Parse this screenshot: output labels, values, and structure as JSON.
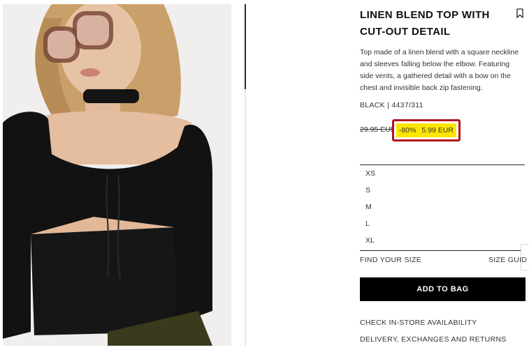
{
  "product": {
    "title": "LINEN BLEND TOP WITH CUT-OUT DETAIL",
    "description": "Top made of a linen blend with a square neckline and sleeves falling below the elbow. Featuring side vents, a gathered detail with a bow on the chest and invisible back zip fastening.",
    "color_ref": "BLACK | 4437/311",
    "old_price": "29.95 EUR",
    "discount": "-80%",
    "price": "5.99 EUR"
  },
  "sizes": [
    "XS",
    "S",
    "M",
    "L",
    "XL"
  ],
  "links": {
    "find_size": "FIND YOUR SIZE",
    "size_guide": "SIZE GUID",
    "add_to_bag": "ADD TO BAG",
    "store_availability": "CHECK IN-STORE AVAILABILITY",
    "delivery": "DELIVERY, EXCHANGES AND RETURNS"
  },
  "colors": {
    "highlight": "#ffe600",
    "highlight_border": "#b3121d",
    "button_bg": "#000000"
  },
  "icons": {
    "bookmark": "bookmark-icon"
  }
}
